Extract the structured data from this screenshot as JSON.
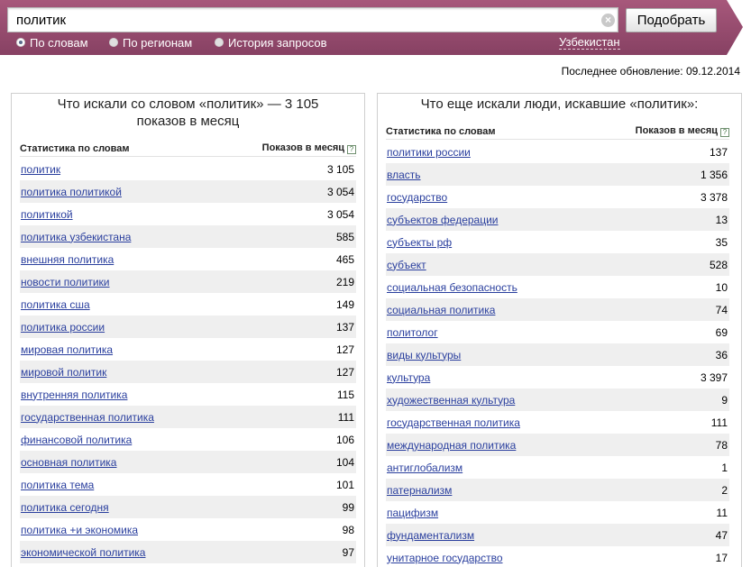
{
  "search": {
    "value": "политик",
    "button": "Подобрать"
  },
  "modes": [
    "По словам",
    "По регионам",
    "История запросов"
  ],
  "region": "Узбекистан",
  "update": "Последнее обновление: 09.12.2014",
  "left": {
    "title_line1": "Что искали со словом «политик» — 3 105",
    "title_line2": "показов в месяц",
    "col1": "Статистика по словам",
    "col2": "Показов в месяц",
    "help": "?",
    "rows": [
      {
        "q": "политик",
        "n": "3 105"
      },
      {
        "q": "политика политикой",
        "n": "3 054"
      },
      {
        "q": "политикой",
        "n": "3 054"
      },
      {
        "q": "политика узбекистана",
        "n": "585"
      },
      {
        "q": "внешняя политика",
        "n": "465"
      },
      {
        "q": "новости политики",
        "n": "219"
      },
      {
        "q": "политика сша",
        "n": "149"
      },
      {
        "q": "политика россии",
        "n": "137"
      },
      {
        "q": "мировая политика",
        "n": "127"
      },
      {
        "q": "мировой политик",
        "n": "127"
      },
      {
        "q": "внутренняя политика",
        "n": "115"
      },
      {
        "q": "государственная политика",
        "n": "111"
      },
      {
        "q": "финансовой политика",
        "n": "106"
      },
      {
        "q": "основная политика",
        "n": "104"
      },
      {
        "q": "политика тема",
        "n": "101"
      },
      {
        "q": "политика сегодня",
        "n": "99"
      },
      {
        "q": "политика +и экономика",
        "n": "98"
      },
      {
        "q": "экономической политика",
        "n": "97"
      }
    ]
  },
  "right": {
    "title": "Что еще искали люди, искавшие «политик»:",
    "col1": "Статистика по словам",
    "col2": "Показов в месяц",
    "help": "?",
    "rows": [
      {
        "q": "политики россии",
        "n": "137"
      },
      {
        "q": "власть",
        "n": "1 356"
      },
      {
        "q": "государство",
        "n": "3 378"
      },
      {
        "q": "субъектов федерации",
        "n": "13"
      },
      {
        "q": "субъекты рф",
        "n": "35"
      },
      {
        "q": "субъект",
        "n": "528"
      },
      {
        "q": "социальная безопасность",
        "n": "10"
      },
      {
        "q": "социальная политика",
        "n": "74"
      },
      {
        "q": "политолог",
        "n": "69"
      },
      {
        "q": "виды культуры",
        "n": "36"
      },
      {
        "q": "культура",
        "n": "3 397"
      },
      {
        "q": "художественная культура",
        "n": "9"
      },
      {
        "q": "государственная политика",
        "n": "111"
      },
      {
        "q": "международная политика",
        "n": "78"
      },
      {
        "q": "антиглобализм",
        "n": "1"
      },
      {
        "q": "патернализм",
        "n": "2"
      },
      {
        "q": "пацифизм",
        "n": "11"
      },
      {
        "q": "фундаментализм",
        "n": "47"
      },
      {
        "q": "унитарное государство",
        "n": "17"
      }
    ]
  }
}
